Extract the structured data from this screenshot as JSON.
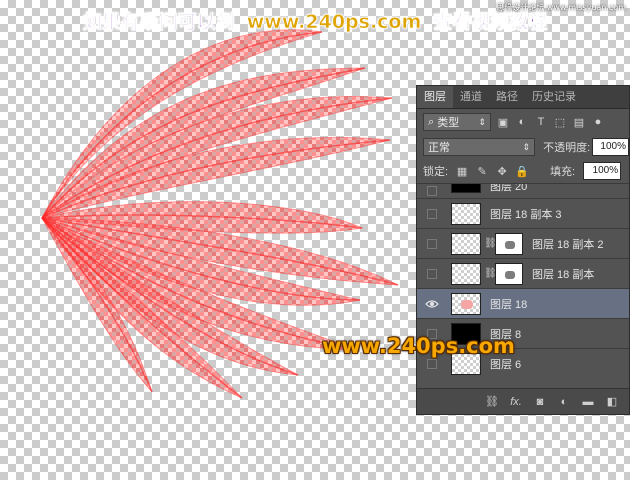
{
  "banner": {
    "left_text": "如果有疑问可以到",
    "url": "www.240ps.com",
    "right_text": "查看视频教程"
  },
  "watermark": "思缘设计论坛 www.missyuan.com",
  "overlay_url": "www.240ps.com",
  "panel": {
    "tabs": [
      "图层",
      "通道",
      "路径",
      "历史记录"
    ],
    "active_tab": "图层",
    "filter_kind": "类型",
    "blend_mode": "正常",
    "opacity_label": "不透明度:",
    "opacity_value": "100%",
    "lock_label": "锁定:",
    "fill_label": "填充:",
    "fill_value": "100%",
    "layers": [
      {
        "name": "图层 20",
        "visible": false,
        "thumb": "black",
        "partial": true
      },
      {
        "name": "图层 18 副本 3",
        "visible": false,
        "thumb": "transparent",
        "mask": false
      },
      {
        "name": "图层 18 副本 2",
        "visible": false,
        "thumb": "transparent",
        "mask": true
      },
      {
        "name": "图层 18 副本",
        "visible": false,
        "thumb": "transparent",
        "mask": true
      },
      {
        "name": "图层 18",
        "visible": true,
        "thumb": "pink",
        "mask": false,
        "selected": true
      },
      {
        "name": "图层 8",
        "visible": false,
        "thumb": "black",
        "mask": false
      },
      {
        "name": "图层 6",
        "visible": false,
        "thumb": "transparent",
        "mask": false
      }
    ],
    "bottom_icons": [
      "link-icon",
      "fx-icon",
      "mask-icon",
      "adjustment-icon",
      "group-icon",
      "new-layer-icon"
    ],
    "bottom_fx": "fx."
  },
  "colors": {
    "wing": "#ff3a3a",
    "panel": "#535353",
    "selected_row": "#687184",
    "url": "#f6a800",
    "banner_cn": "#7d2fb0"
  }
}
